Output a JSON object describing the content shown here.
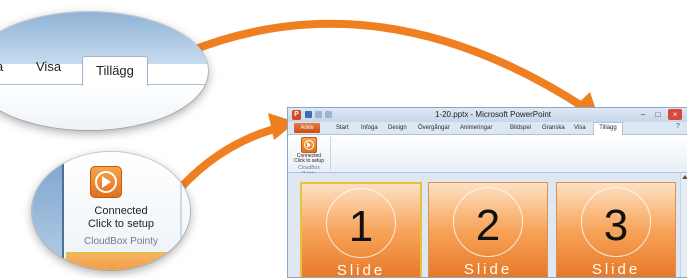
{
  "zoom_top": {
    "partial_tab": "a",
    "tab_view": "Visa",
    "tab_addins": "Tillägg"
  },
  "zoom_bottom": {
    "line1": "Connected",
    "line2": "Click to setup",
    "group": "CloudBox Pointy"
  },
  "arrows": {
    "color": "#f07f22"
  },
  "window": {
    "title": "1-20.pptx - Microsoft PowerPoint",
    "app_letter": "P",
    "controls": {
      "minimize": "–",
      "maximize": "□",
      "close": "×"
    },
    "help": "?",
    "tabs": [
      "Arkiv",
      "Start",
      "Infoga",
      "Design",
      "Övergångar",
      "Animeringar",
      "Bildspel",
      "Granska",
      "Visa",
      "Tillägg"
    ],
    "active_tab": "Tillägg",
    "ribbon": {
      "line1": "Connected",
      "line2": "Click to setup",
      "group": "CloudBox Pointy"
    },
    "slides": [
      {
        "number": "1",
        "caption": "Slide"
      },
      {
        "number": "2",
        "caption": "Slide"
      },
      {
        "number": "3",
        "caption": "Slide"
      }
    ]
  }
}
